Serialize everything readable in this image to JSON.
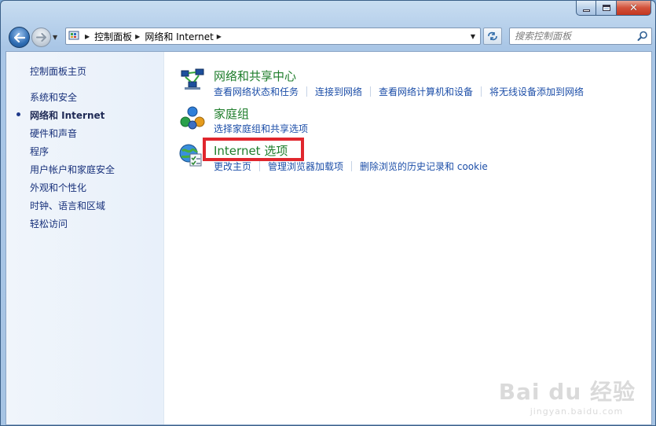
{
  "window": {
    "minimize_label": "",
    "close_label": "✕"
  },
  "nav": {
    "breadcrumbs": [
      "控制面板",
      "网络和 Internet"
    ],
    "search_placeholder": "搜索控制面板"
  },
  "sidebar": {
    "home": "控制面板主页",
    "items": [
      {
        "label": "系统和安全",
        "current": false
      },
      {
        "label": "网络和 Internet",
        "current": true
      },
      {
        "label": "硬件和声音",
        "current": false
      },
      {
        "label": "程序",
        "current": false
      },
      {
        "label": "用户帐户和家庭安全",
        "current": false
      },
      {
        "label": "外观和个性化",
        "current": false
      },
      {
        "label": "时钟、语言和区域",
        "current": false
      },
      {
        "label": "轻松访问",
        "current": false
      }
    ]
  },
  "categories": [
    {
      "title": "网络和共享中心",
      "icon": "network-sharing-center-icon",
      "links": [
        "查看网络状态和任务",
        "连接到网络",
        "查看网络计算机和设备",
        "将无线设备添加到网络"
      ]
    },
    {
      "title": "家庭组",
      "icon": "homegroup-icon",
      "links": [
        "选择家庭组和共享选项"
      ]
    },
    {
      "title": "Internet 选项",
      "icon": "internet-options-icon",
      "links": [
        "更改主页",
        "管理浏览器加载项",
        "删除浏览的历史记录和 cookie"
      ]
    }
  ],
  "watermark": {
    "logo": "Bai du 经验",
    "url": "jingyan.baidu.com"
  },
  "colors": {
    "category_title": "#1e7d2b",
    "link": "#1c4ea8",
    "highlight": "#e0262d"
  }
}
